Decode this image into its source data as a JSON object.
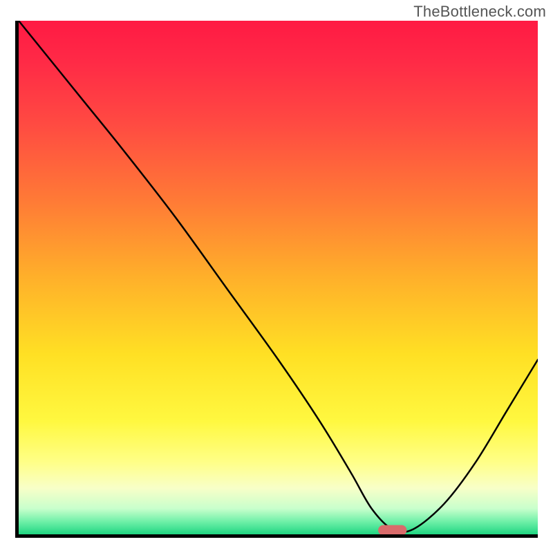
{
  "attribution": "TheBottleneck.com",
  "chart_data": {
    "type": "line",
    "title": "",
    "xlabel": "",
    "ylabel": "",
    "xlim": [
      0,
      100
    ],
    "ylim": [
      0,
      100
    ],
    "grid": false,
    "series": [
      {
        "name": "bottleneck-curve",
        "x": [
          0,
          12,
          20,
          30,
          40,
          50,
          58,
          64,
          68,
          72,
          76,
          82,
          88,
          94,
          100
        ],
        "values": [
          100,
          85,
          75,
          62,
          48,
          34,
          22,
          12,
          5,
          1,
          1,
          6,
          14,
          24,
          34
        ]
      }
    ],
    "markers": [
      {
        "name": "optimal-marker",
        "x": 72,
        "y": 0.8,
        "color": "#d96b6b"
      }
    ],
    "background_gradient": {
      "stops": [
        {
          "offset": 0.0,
          "color": "#ff1a44"
        },
        {
          "offset": 0.08,
          "color": "#ff2a46"
        },
        {
          "offset": 0.2,
          "color": "#ff4a42"
        },
        {
          "offset": 0.35,
          "color": "#ff7a36"
        },
        {
          "offset": 0.5,
          "color": "#ffb02a"
        },
        {
          "offset": 0.65,
          "color": "#ffe024"
        },
        {
          "offset": 0.78,
          "color": "#fff840"
        },
        {
          "offset": 0.86,
          "color": "#ffff88"
        },
        {
          "offset": 0.91,
          "color": "#f8ffc8"
        },
        {
          "offset": 0.95,
          "color": "#c8ffcc"
        },
        {
          "offset": 0.975,
          "color": "#70f0a8"
        },
        {
          "offset": 1.0,
          "color": "#20d682"
        }
      ]
    }
  }
}
